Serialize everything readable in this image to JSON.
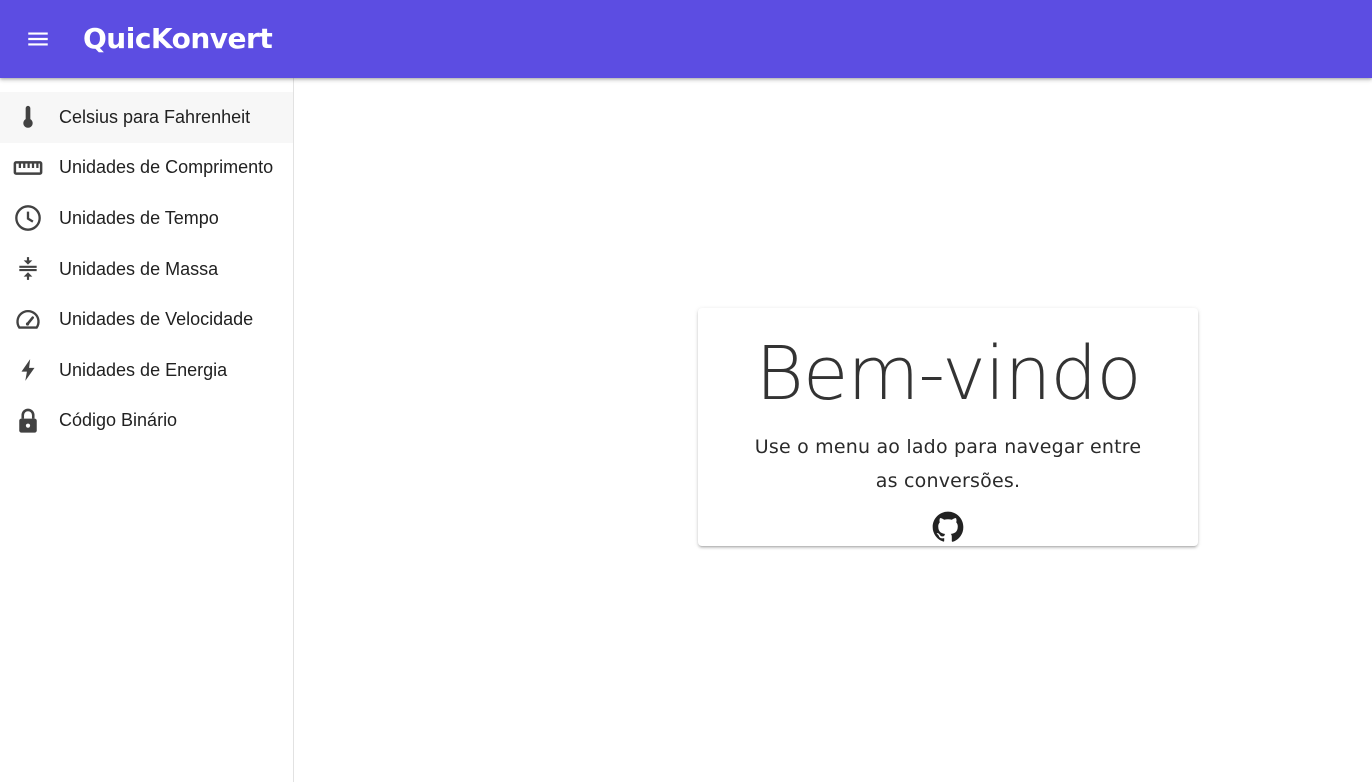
{
  "app_bar": {
    "title": "QuicKonvert",
    "menu_icon": "hamburger-menu-icon",
    "color": "#5c4de2"
  },
  "sidebar": {
    "items": [
      {
        "label": "Celsius para Fahrenheit",
        "icon": "thermometer-icon",
        "active": true
      },
      {
        "label": "Unidades de Comprimento",
        "icon": "ruler-icon",
        "active": false
      },
      {
        "label": "Unidades de Tempo",
        "icon": "clock-icon",
        "active": false
      },
      {
        "label": "Unidades de Massa",
        "icon": "compress-icon",
        "active": false
      },
      {
        "label": "Unidades de Velocidade",
        "icon": "speedometer-icon",
        "active": false
      },
      {
        "label": "Unidades de Energia",
        "icon": "lightning-bolt-icon",
        "active": false
      },
      {
        "label": "Código Binário",
        "icon": "lock-icon",
        "active": false
      }
    ]
  },
  "welcome_card": {
    "title": "Bem-vindo",
    "text": "Use o menu ao lado para navegar entre as conversões.",
    "link_icon": "github-icon"
  }
}
